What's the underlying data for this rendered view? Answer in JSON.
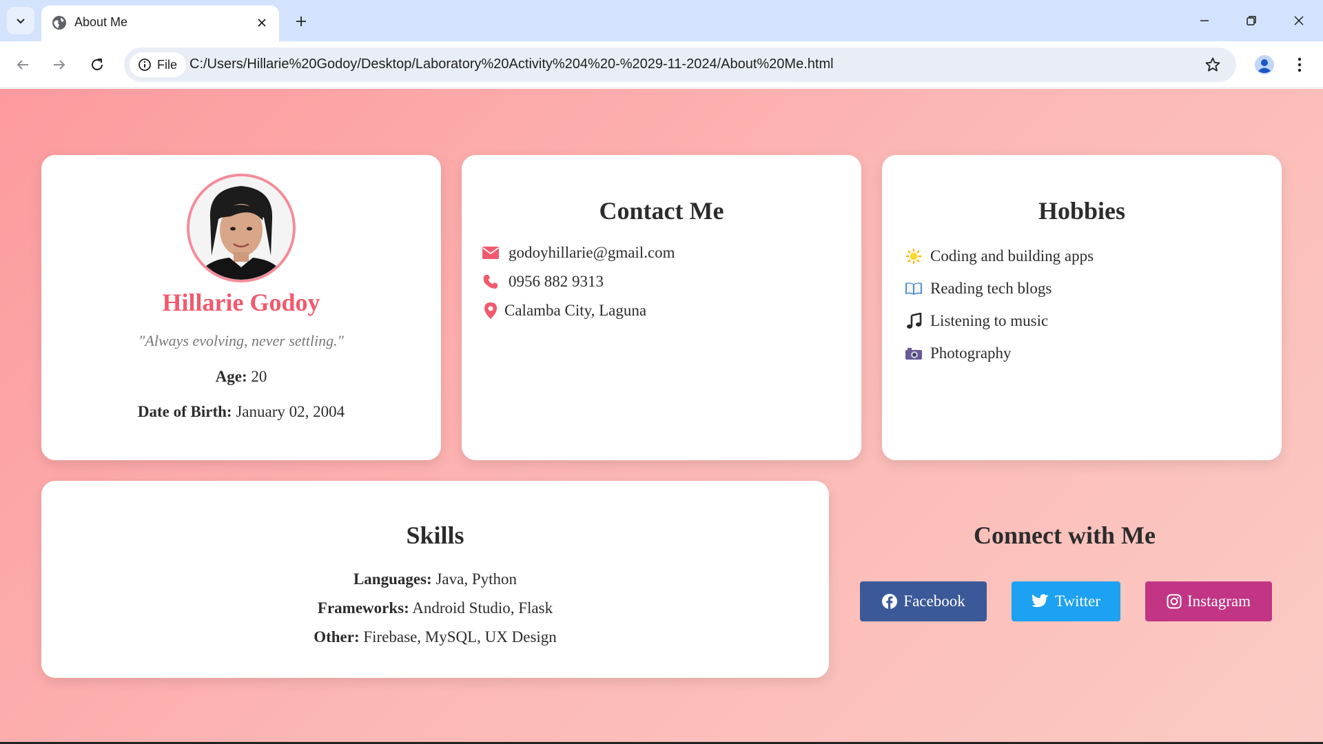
{
  "browser": {
    "tab_title": "About Me",
    "site_chip_label": "File",
    "url": "C:/Users/Hillarie%20Godoy/Desktop/Laboratory%20Activity%204%20-%2029-11-2024/About%20Me.html"
  },
  "profile": {
    "name": "Hillarie Godoy",
    "quote": "\"Always evolving, never settling.\"",
    "age_label": "Age:",
    "age_value": "20",
    "dob_label": "Date of Birth:",
    "dob_value": "January 02, 2004"
  },
  "contact": {
    "title": "Contact Me",
    "items": [
      {
        "icon": "envelope-icon",
        "text": "godoyhillarie@gmail.com"
      },
      {
        "icon": "phone-icon",
        "text": "0956 882 9313"
      },
      {
        "icon": "location-pin-icon",
        "text": "Calamba City, Laguna"
      }
    ]
  },
  "hobbies": {
    "title": "Hobbies",
    "items": [
      {
        "icon": "sun-icon",
        "text": "Coding and building apps"
      },
      {
        "icon": "open-book-icon",
        "text": "Reading tech blogs"
      },
      {
        "icon": "music-note-icon",
        "text": "Listening to music"
      },
      {
        "icon": "camera-icon",
        "text": "Photography"
      }
    ]
  },
  "skills": {
    "title": "Skills",
    "languages_label": "Languages:",
    "languages_value": "Java, Python",
    "frameworks_label": "Frameworks:",
    "frameworks_value": "Android Studio, Flask",
    "other_label": "Other:",
    "other_value": "Firebase, MySQL, UX Design"
  },
  "connect": {
    "title": "Connect with Me",
    "facebook": "Facebook",
    "twitter": "Twitter",
    "instagram": "Instagram"
  },
  "colors": {
    "accent_name": "#f2596d",
    "icon_pink": "#f2596d",
    "facebook": "#3b5998",
    "twitter": "#1da1f2",
    "instagram": "#c13584",
    "chrome_tabbar": "#d3e3fd"
  }
}
